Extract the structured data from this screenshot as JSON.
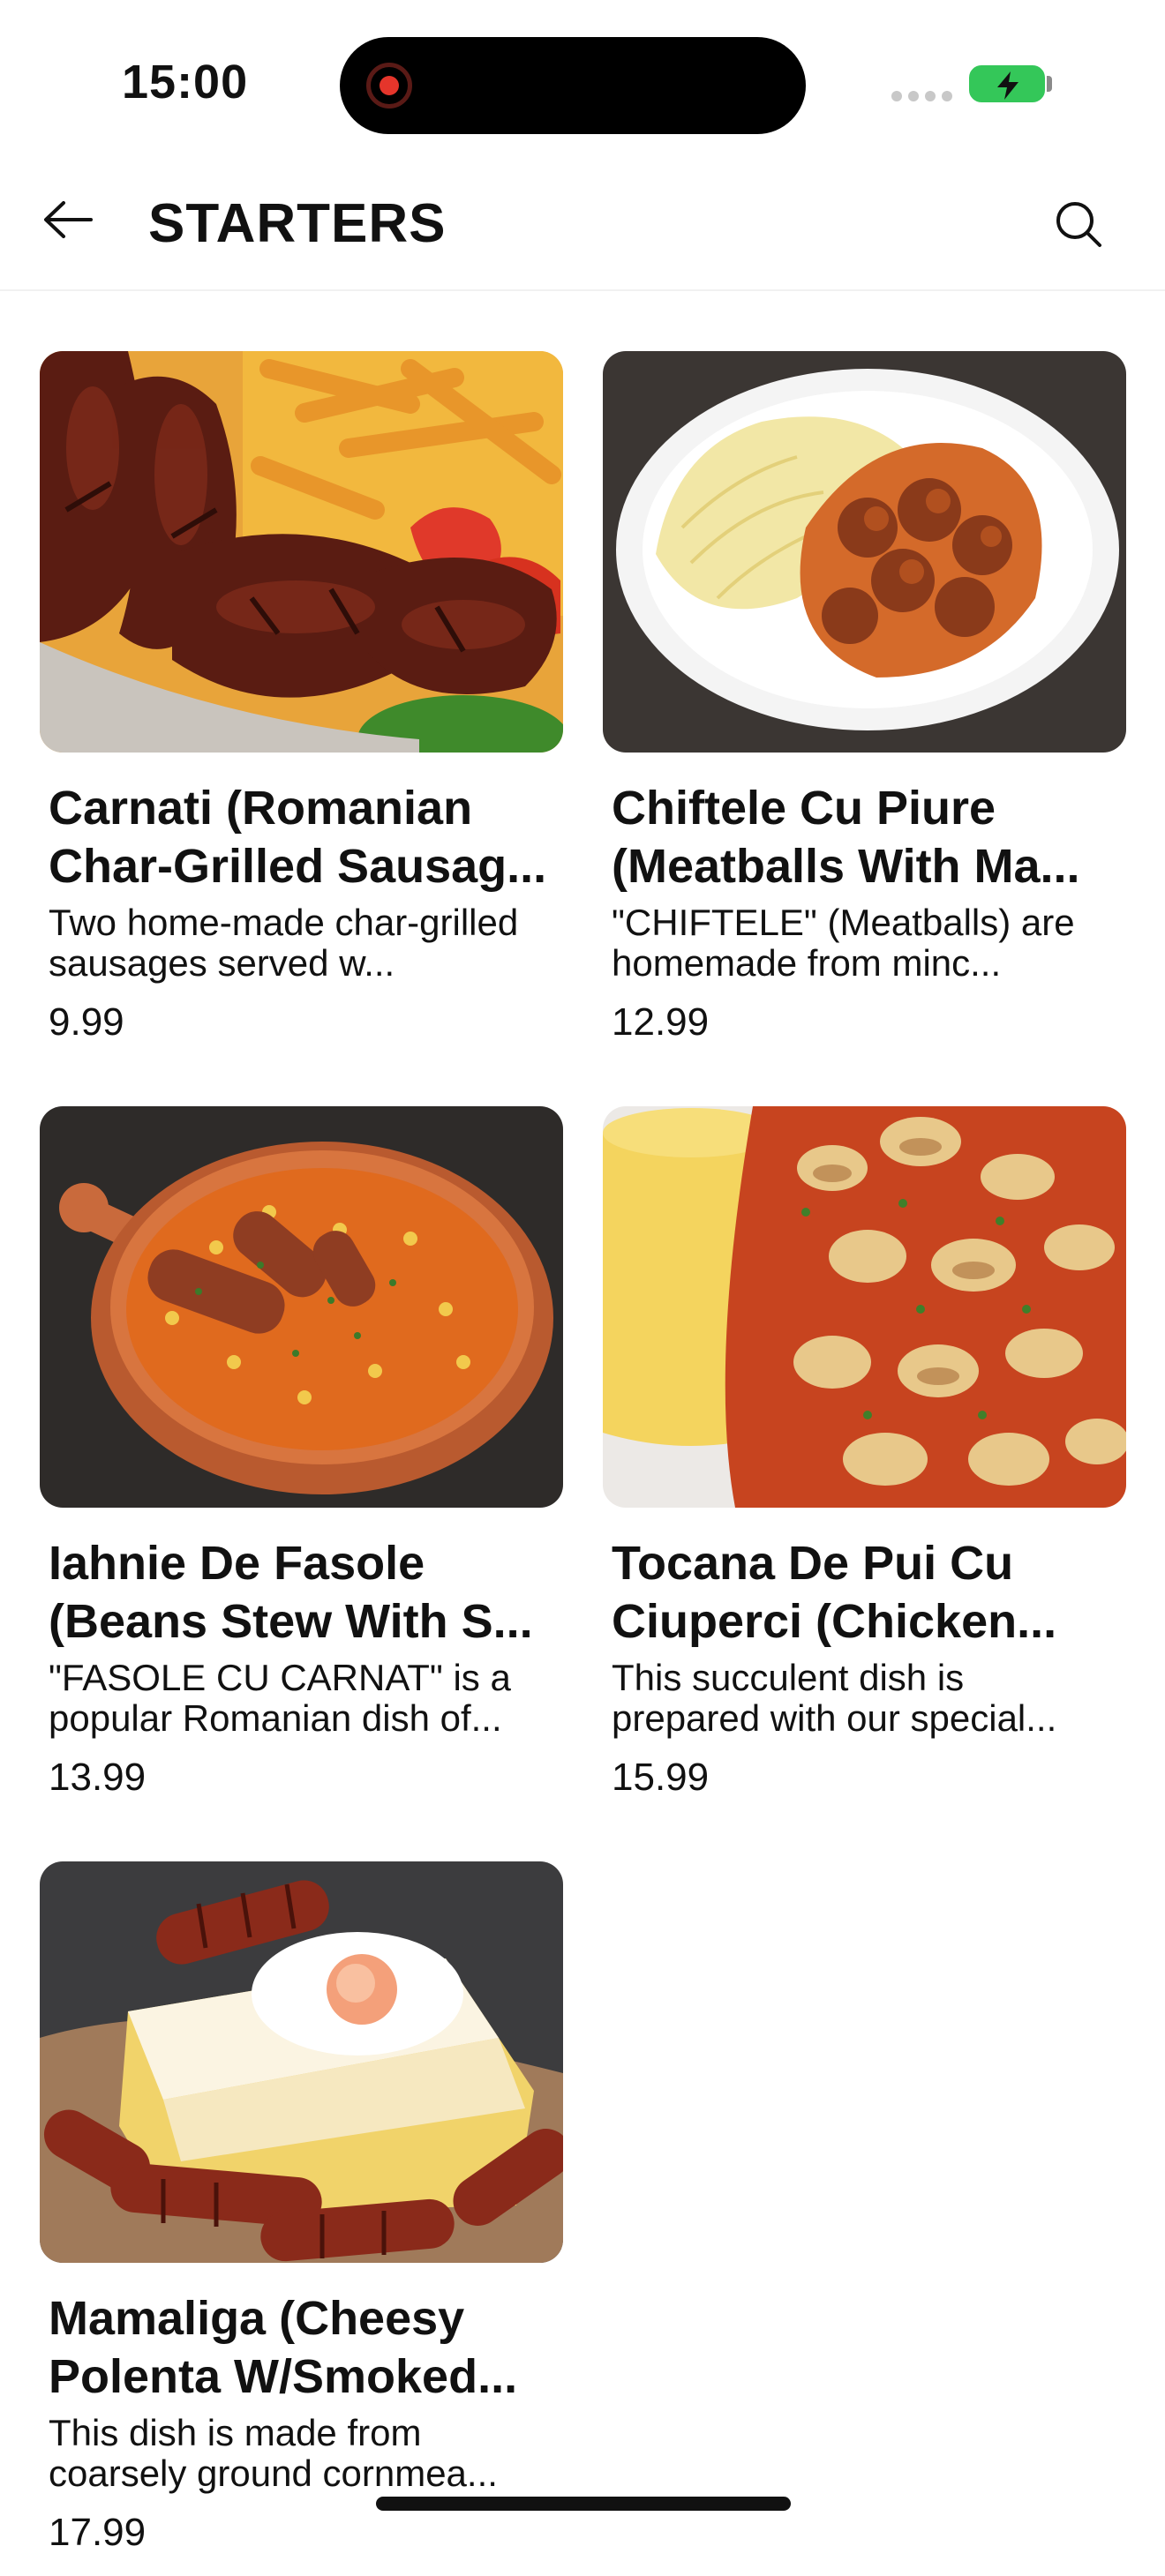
{
  "status_bar": {
    "time": "15:00"
  },
  "header": {
    "title": "STARTERS",
    "back_icon": "arrow-left-icon",
    "search_icon": "search-icon"
  },
  "items": [
    {
      "name": "Carnati (Romanian Char-Grilled Sausag...",
      "description": "Two home-made char-grilled sausages served w...",
      "price": "9.99"
    },
    {
      "name": "Chiftele Cu Piure (Meatballs With Ma...",
      "description": "\"CHIFTELE\" (Meatballs) are homemade from minc...",
      "price": "12.99"
    },
    {
      "name": "Iahnie De Fasole (Beans Stew With S...",
      "description": "\"FASOLE CU CARNAT\" is a popular Romanian dish of...",
      "price": "13.99"
    },
    {
      "name": "Tocana De Pui Cu Ciuperci (Chicken...",
      "description": "This succulent dish is prepared with our special...",
      "price": "15.99"
    },
    {
      "name": "Mamaliga (Cheesy Polenta W/Smoked...",
      "description": "This dish is made from coarsely ground cornmea...",
      "price": "17.99"
    }
  ],
  "colors": {
    "battery": "#34c759",
    "record_dot": "#e5352b"
  }
}
